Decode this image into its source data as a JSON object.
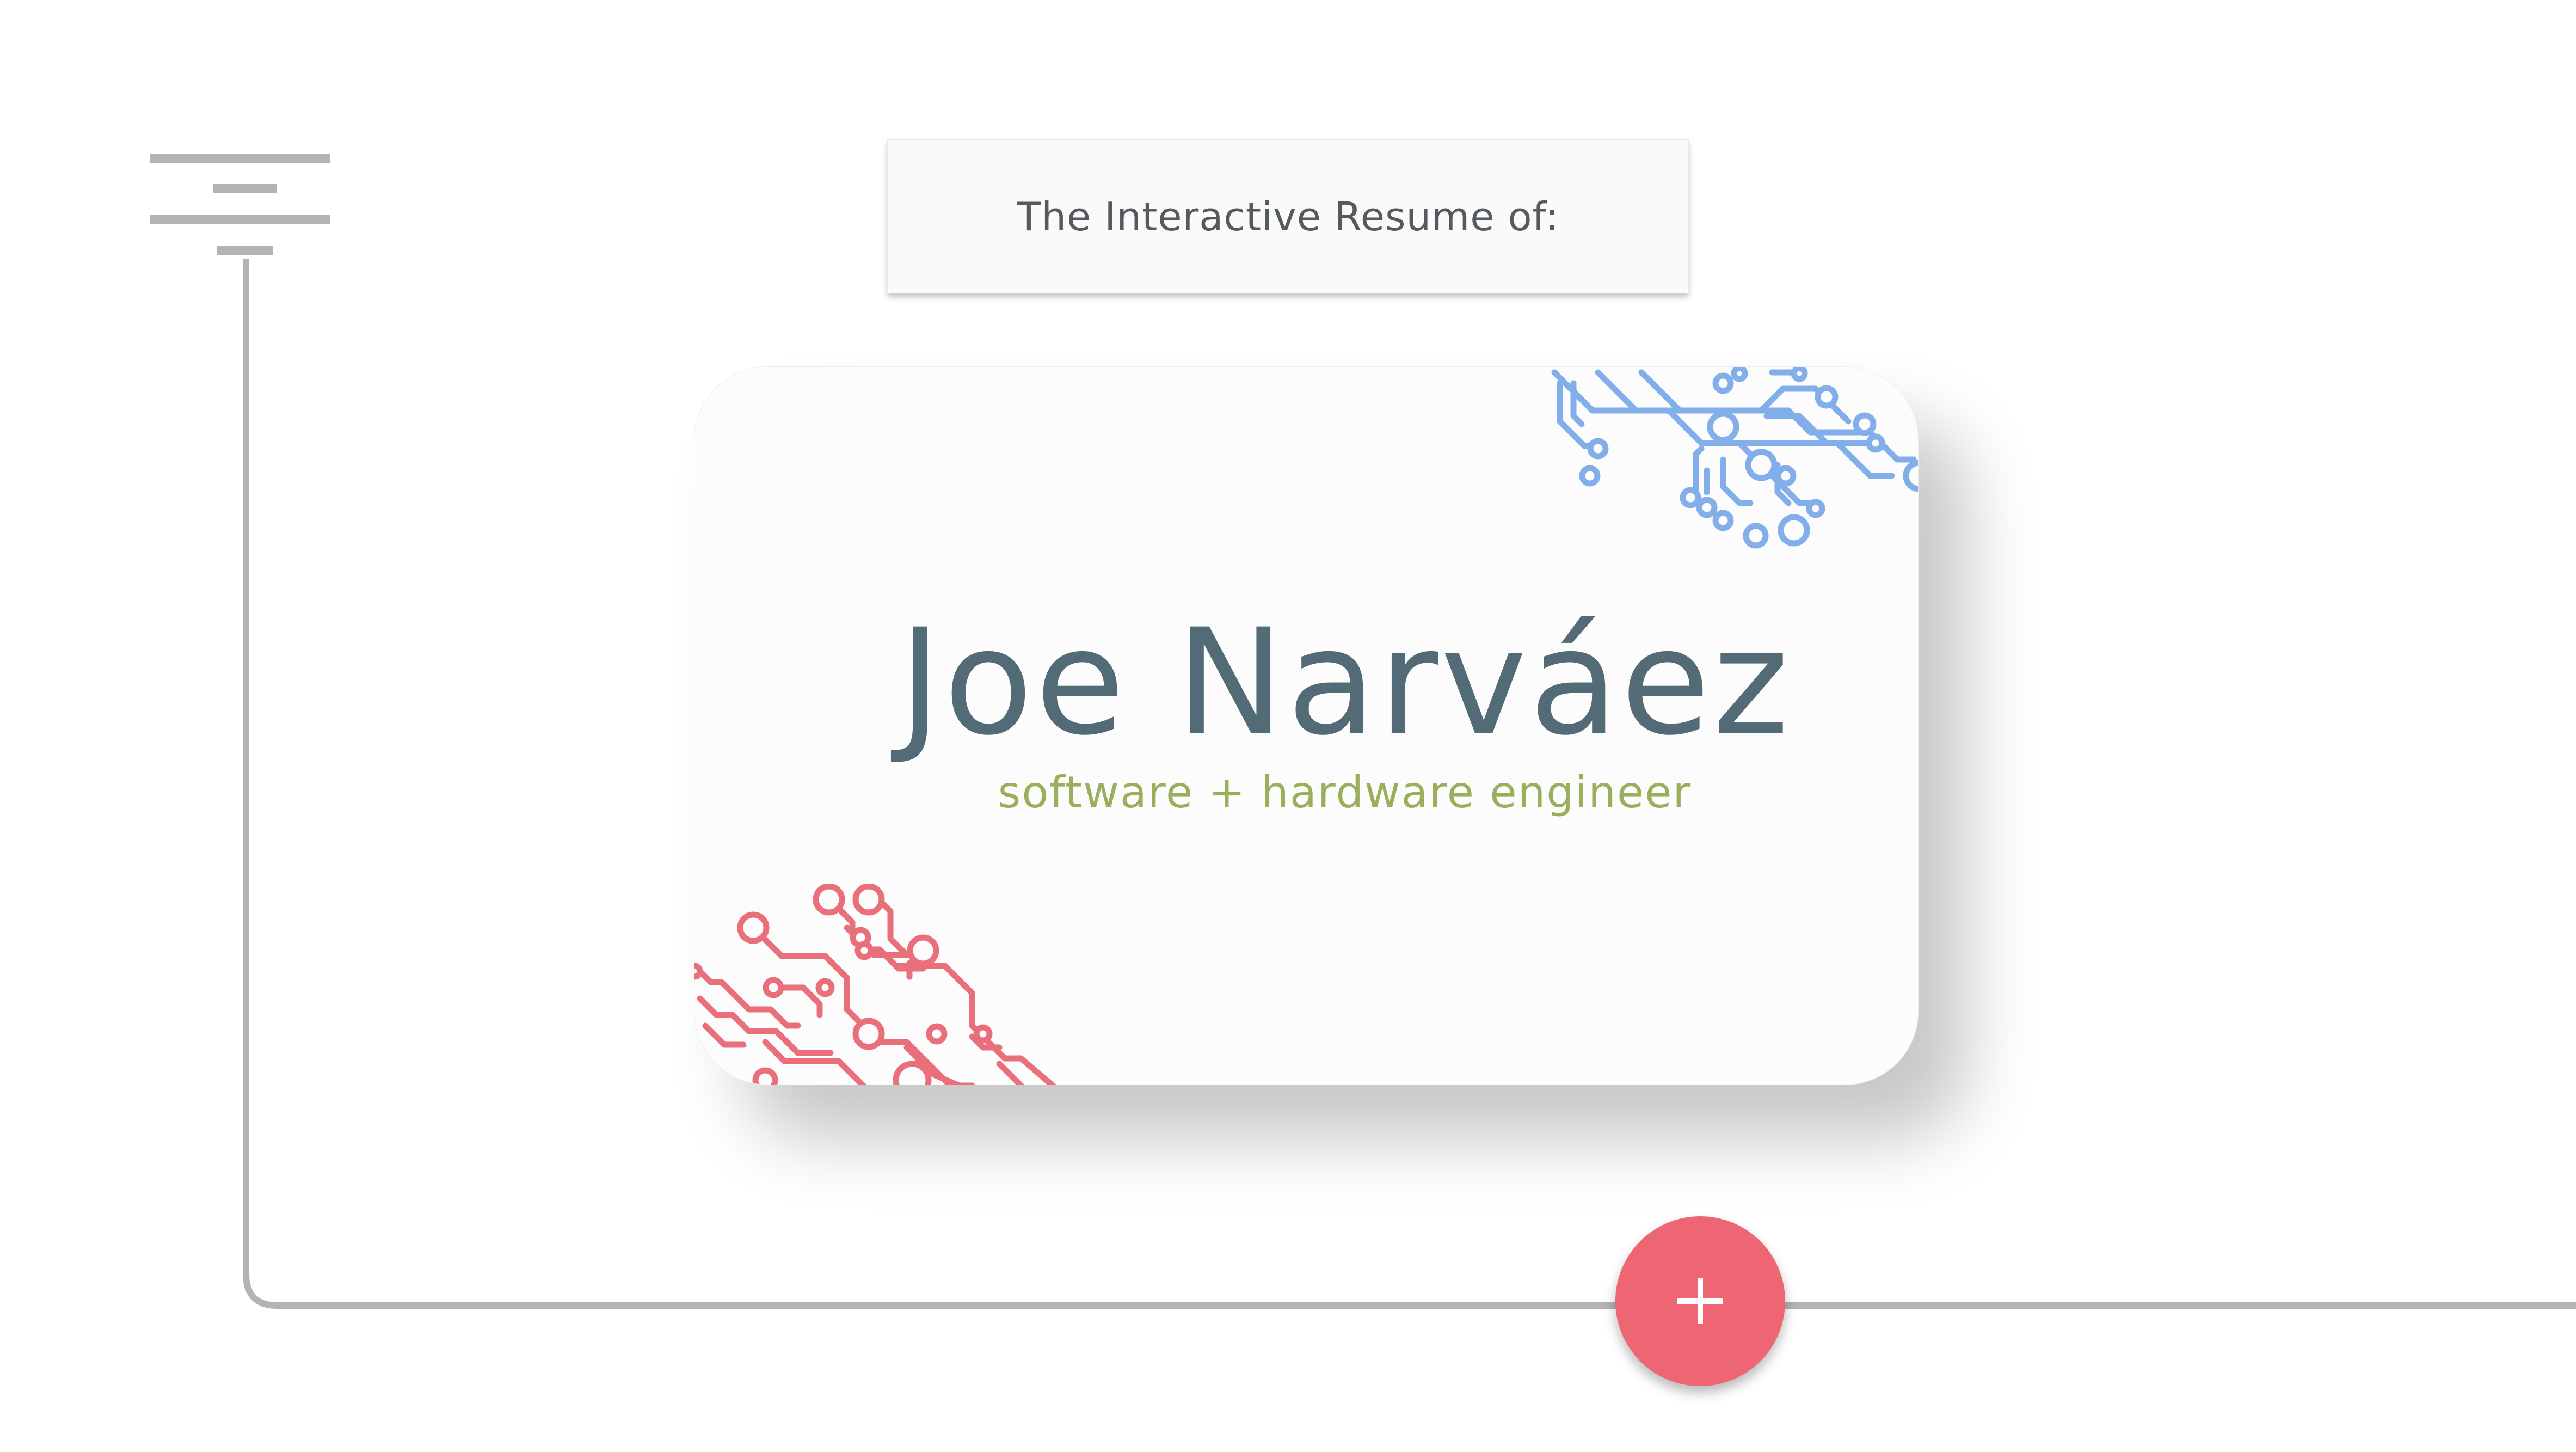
{
  "header": {
    "intro_text": "The Interactive Resume of:"
  },
  "card": {
    "name": "Joe Narváez",
    "tagline": "software + hardware engineer"
  },
  "icons": {
    "menu": "menu-lines-icon",
    "add": "plus-icon",
    "top_circuit": "circuit-trace-icon",
    "bottom_circuit": "circuit-trace-icon"
  },
  "colors": {
    "background": "#ffffff",
    "timeline_line": "#b3b3b3",
    "name": "#526b77",
    "tagline": "#9aaf5b",
    "circuit_blue": "#82aeea",
    "circuit_red": "#e9707a",
    "add_button": "#ee6673"
  }
}
